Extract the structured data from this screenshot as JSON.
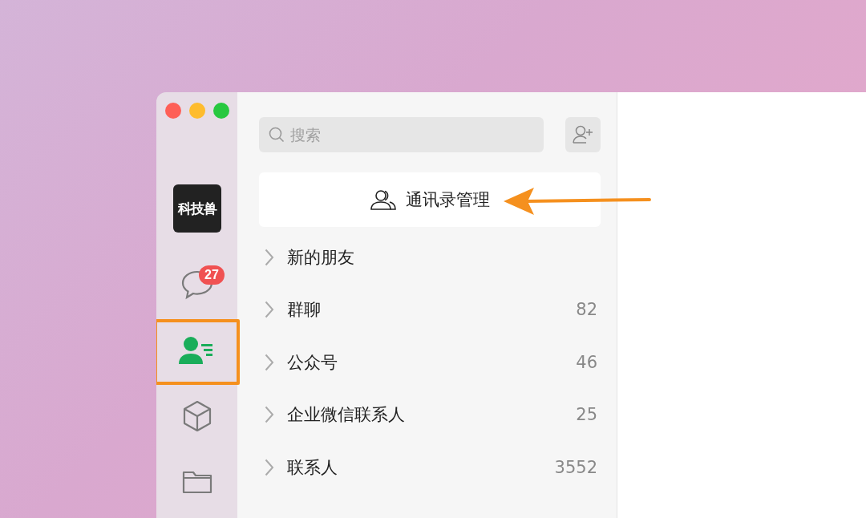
{
  "sidebar": {
    "logo": "科技兽",
    "nav": [
      {
        "kind": "chat",
        "badge": "27",
        "selected": false,
        "highlighted": false
      },
      {
        "kind": "contacts",
        "selected": true,
        "highlighted": true
      },
      {
        "kind": "cube",
        "selected": false,
        "highlighted": false
      },
      {
        "kind": "folder",
        "selected": false,
        "highlighted": false
      }
    ]
  },
  "search": {
    "placeholder": "搜索"
  },
  "manage_button": {
    "label": "通讯录管理"
  },
  "groups": [
    {
      "label": "新的朋友"
    },
    {
      "label": "群聊",
      "count": "82"
    },
    {
      "label": "公众号",
      "count": "46"
    },
    {
      "label": "企业微信联系人",
      "count": "25"
    },
    {
      "label": "联系人",
      "count": "3552"
    }
  ]
}
